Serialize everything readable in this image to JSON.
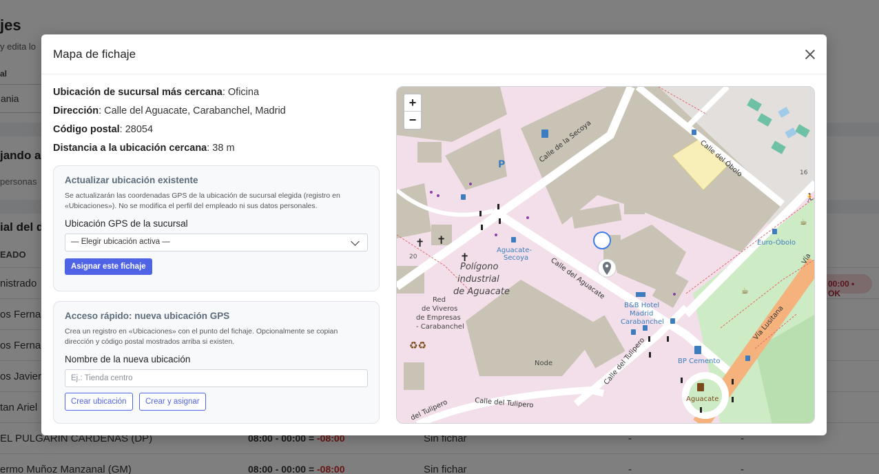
{
  "background": {
    "title": "jes",
    "subtitle": "y edita lo",
    "filter_label": "al",
    "filter_value": "ania",
    "section1": "jando a",
    "section1_sub": "personas",
    "section2": "ial del d",
    "table_header": "EADO",
    "ok_badge": "00:00 • OK",
    "rows": [
      {
        "name": "nistrado",
        "time": "",
        "neg": "",
        "status": "",
        "d1": "",
        "d2": ""
      },
      {
        "name": "os Fernan",
        "time": "",
        "neg": "",
        "status": "",
        "d1": "",
        "d2": ""
      },
      {
        "name": "os Fernan",
        "time": "",
        "neg": "",
        "status": "",
        "d1": "",
        "d2": ""
      },
      {
        "name": "os Javier",
        "time": "",
        "neg": "",
        "status": "",
        "d1": "",
        "d2": ""
      },
      {
        "name": "tan Ariel",
        "time": "",
        "neg": "",
        "status": "",
        "d1": "",
        "d2": ""
      },
      {
        "name": "EL PULGARIN CARDENAS (DP)",
        "time": "08:00 - 00:00 = ",
        "neg": "-08:00",
        "status": "Sin fichar",
        "d1": "-",
        "d2": "-"
      },
      {
        "name": "ermo Muñoz Manzanal (GM)",
        "time": "08:00 - 00:00 = ",
        "neg": "-08:00",
        "status": "Sin fichar",
        "d1": "-",
        "d2": "-"
      }
    ]
  },
  "modal": {
    "title": "Mapa de fichaje",
    "info": {
      "nearest_label": "Ubicación de sucursal más cercana",
      "nearest_value": ": Oficina",
      "address_label": "Dirección",
      "address_value": ": Calle del Aguacate, Carabanchel, Madrid",
      "postal_label": "Código postal",
      "postal_value": ": 28054",
      "distance_label": "Distancia a la ubicación cercana",
      "distance_value": ": 38 m"
    },
    "update_card": {
      "title": "Actualizar ubicación existente",
      "help": "Se actualizarán las coordenadas GPS de la ubicación de sucursal elegida (registro en «Ubicaciones»). No se modifica el perfil del empleado ni sus datos personales.",
      "select_label": "Ubicación GPS de la sucursal",
      "select_value": "— Elegir ubicación activa —",
      "assign_button": "Asignar este fichaje"
    },
    "quick_card": {
      "title": "Acceso rápido: nueva ubicación GPS",
      "help": "Crea un registro en «Ubicaciones» con el punto del fichaje. Opcionalmente se copian dirección y código postal mostrados arriba si existen.",
      "name_label": "Nombre de la nueva ubicación",
      "name_placeholder": "Ej.: Tienda centro",
      "create_button": "Crear ubicación",
      "create_assign_button": "Crear y asignar"
    },
    "map": {
      "zoom_in": "+",
      "zoom_out": "−",
      "labels": {
        "calle_secoya": "Calle de la Secoya",
        "calle_obolo": "Calle del Óbolo",
        "calle_aguacate": "Calle del Aguacate",
        "calle_tulipero": "Calle del Tulipero",
        "calle_tulipero2": "Calle del Tulipero",
        "calle_tulipero3": "del Tulipero",
        "via_lusitana": "Vía Lusitana",
        "poligono1": "Polígono",
        "poligono2": "industrial",
        "poligono3": "de Aguacate",
        "red1": "Red",
        "red2": "de Viveros",
        "red3": "de Empresas",
        "red4": "- Carabanchel",
        "aguacate_secoya1": "Aguacate-",
        "aguacate_secoya2": "Secoya",
        "euro_obolo": "Euro-Óbolo",
        "bb1": "B&B Hotel",
        "bb2": "Madrid",
        "bb3": "Carabanchel",
        "bp": "BP Cemento",
        "aguacate_metro": "Aguacate",
        "node": "Node",
        "num16": "16",
        "num20": "20",
        "parking": "P",
        "via": "Vía"
      }
    }
  }
}
